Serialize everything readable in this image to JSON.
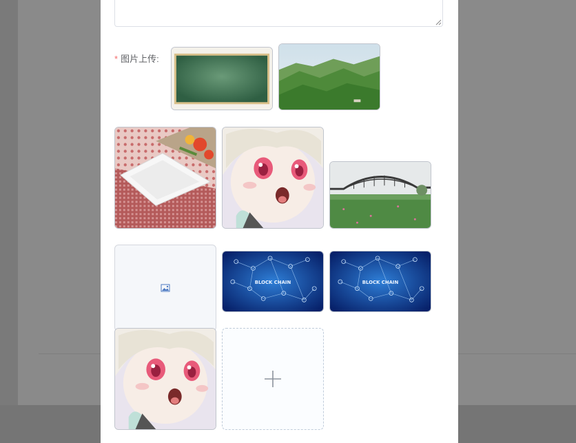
{
  "form": {
    "image_field": {
      "required_mark": "*",
      "label": "图片上传:"
    },
    "images": [
      {
        "name": "chalkboard",
        "alt": "chalkboard"
      },
      {
        "name": "green-mountains",
        "alt": "mountains"
      },
      {
        "name": "white-plate",
        "alt": "plate"
      },
      {
        "name": "anime-girl",
        "alt": "anime"
      },
      {
        "name": "arch-bridge",
        "alt": "bridge"
      },
      {
        "name": "broken-image",
        "alt": ""
      },
      {
        "name": "block-chain",
        "alt": "block chain",
        "caption": "BLOCK CHAIN"
      },
      {
        "name": "block-chain",
        "alt": "block chain",
        "caption": "BLOCK CHAIN"
      },
      {
        "name": "anime-girl",
        "alt": "anime"
      }
    ],
    "upload_button": {
      "icon": "plus-icon"
    }
  },
  "colors": {
    "required": "#f56c6c",
    "label": "#606266",
    "border": "#c0c4cc",
    "upload_border": "#c0ccda",
    "overlay": "#7a7a7a"
  }
}
